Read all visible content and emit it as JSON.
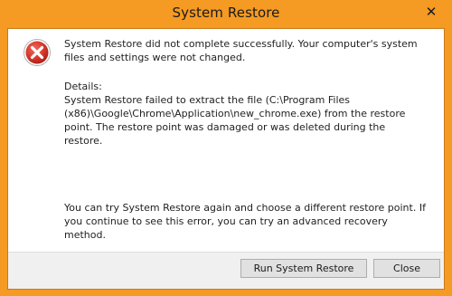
{
  "window": {
    "title": "System Restore",
    "close_glyph": "✕"
  },
  "message": {
    "main": "System Restore did not complete successfully. Your computer's system files and settings were not changed.",
    "details_label": "Details:",
    "details": "System Restore failed to extract the file (C:\\Program Files (x86)\\Google\\Chrome\\Application\\new_chrome.exe) from the restore point. The restore point was damaged or was deleted during the restore.",
    "advice": "You can try System Restore again and choose a different restore point. If you continue to see this error, you can try an advanced recovery method."
  },
  "buttons": {
    "run_label": "Run System Restore",
    "close_label": "Close"
  },
  "icons": {
    "error": "error-icon",
    "close": "close-icon"
  },
  "colors": {
    "title_bar": "#f59a22",
    "error_red": "#d32f2f"
  }
}
